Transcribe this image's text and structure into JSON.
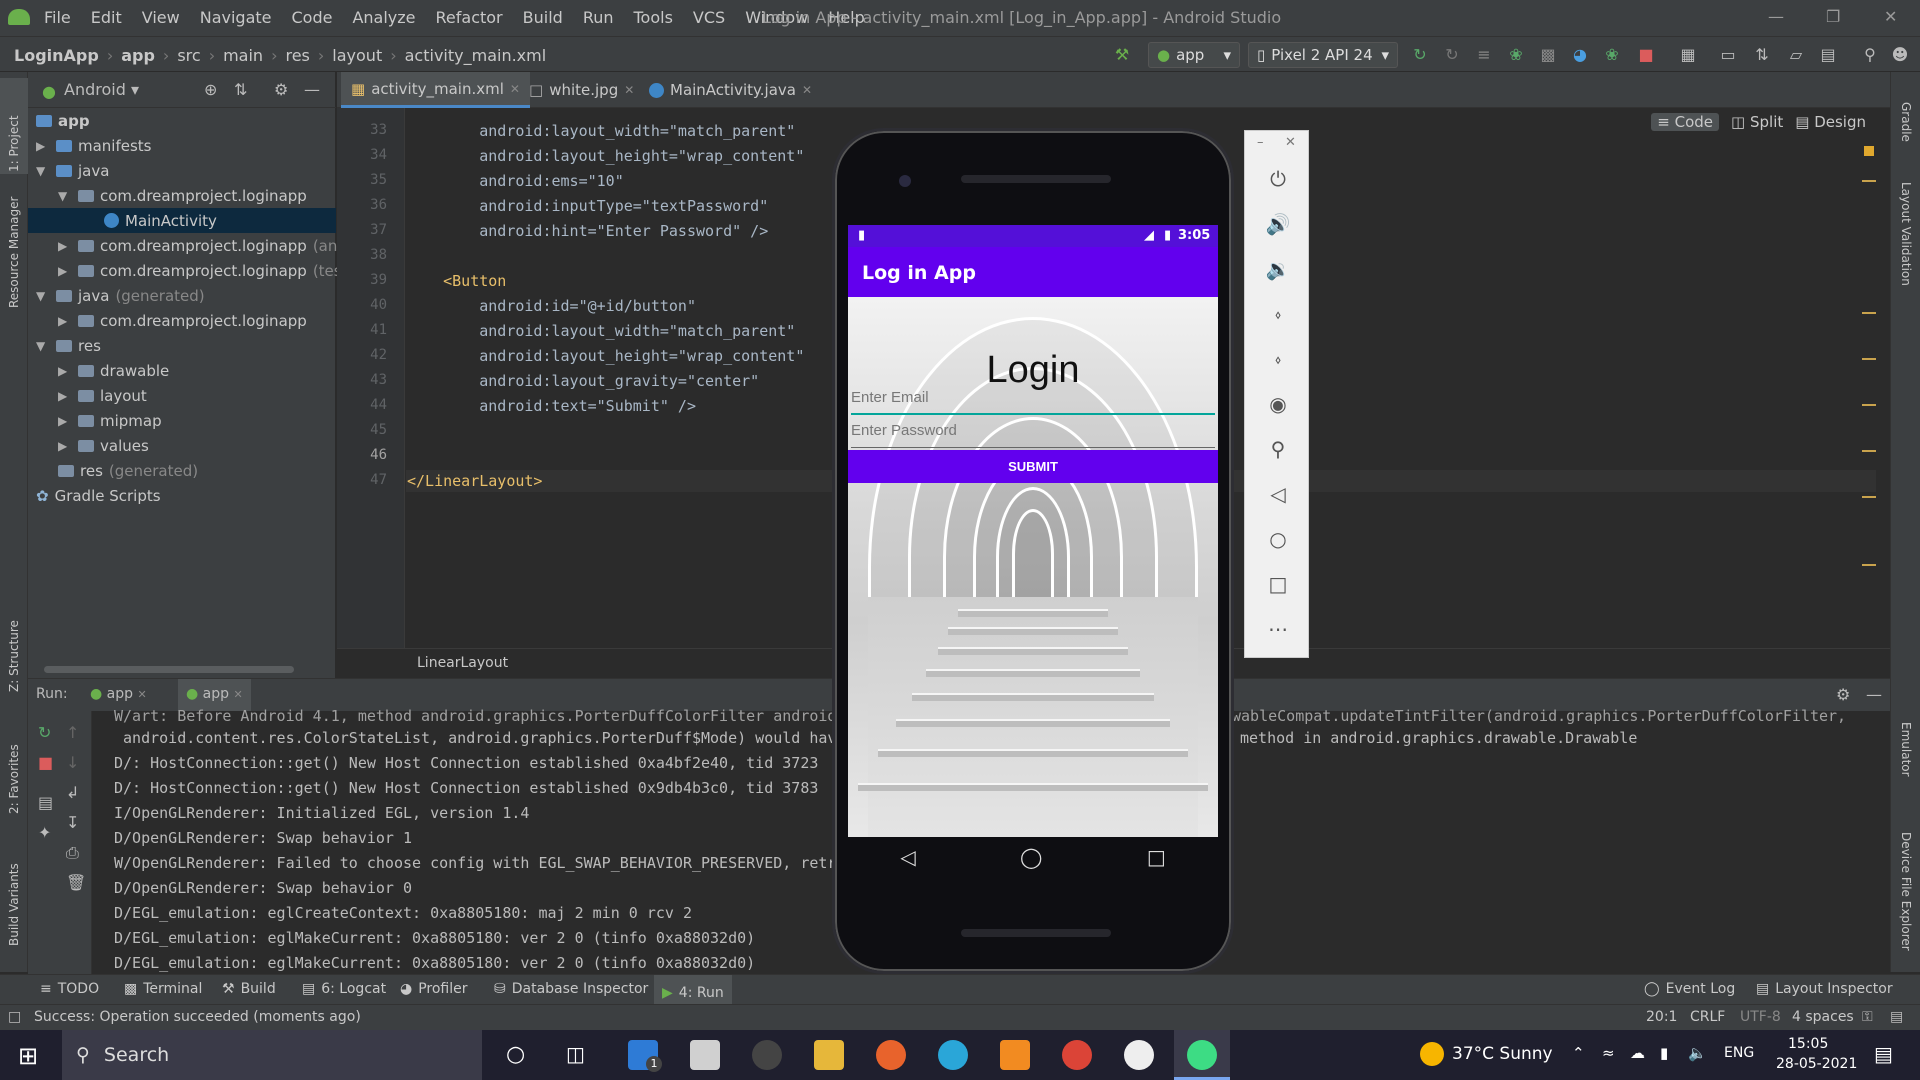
{
  "window": {
    "title": "Log in App - activity_main.xml [Log_in_App.app] - Android Studio",
    "menu": [
      "File",
      "Edit",
      "View",
      "Navigate",
      "Code",
      "Analyze",
      "Refactor",
      "Build",
      "Run",
      "Tools",
      "VCS",
      "Window",
      "Help"
    ]
  },
  "breadcrumb": [
    "LoginApp",
    "app",
    "src",
    "main",
    "res",
    "layout",
    "activity_main.xml"
  ],
  "toolbar": {
    "run_config": "app",
    "device": "Pixel 2 API 24"
  },
  "left_stripe": [
    "1: Project",
    "Resource Manager",
    "Z: Structure",
    "2: Favorites",
    "Build Variants"
  ],
  "right_stripe": [
    "Gradle",
    "Layout Validation",
    "Emulator",
    "Device File Explorer"
  ],
  "project": {
    "view_mode": "Android",
    "tree": [
      {
        "label": "app",
        "suffix": "",
        "icon": "folder",
        "expanded": true
      },
      {
        "label": "manifests",
        "suffix": "",
        "icon": "folder",
        "expanded": false
      },
      {
        "label": "java",
        "suffix": "",
        "icon": "folder",
        "expanded": true
      },
      {
        "label": "com.dreamproject.loginapp",
        "suffix": "",
        "icon": "package",
        "expanded": true
      },
      {
        "label": "MainActivity",
        "suffix": "",
        "icon": "class",
        "selected": true
      },
      {
        "label": "com.dreamproject.loginapp",
        "suffix": "(andro",
        "icon": "package",
        "expanded": false
      },
      {
        "label": "com.dreamproject.loginapp",
        "suffix": "(test)",
        "icon": "package",
        "expanded": false
      },
      {
        "label": "java",
        "suffix": "(generated)",
        "icon": "folder",
        "expanded": true
      },
      {
        "label": "com.dreamproject.loginapp",
        "suffix": "",
        "icon": "package",
        "expanded": false
      },
      {
        "label": "res",
        "suffix": "",
        "icon": "folder",
        "expanded": true
      },
      {
        "label": "drawable",
        "suffix": "",
        "icon": "folder",
        "expanded": false
      },
      {
        "label": "layout",
        "suffix": "",
        "icon": "folder",
        "expanded": false
      },
      {
        "label": "mipmap",
        "suffix": "",
        "icon": "folder",
        "expanded": false
      },
      {
        "label": "values",
        "suffix": "",
        "icon": "folder",
        "expanded": false
      },
      {
        "label": "res",
        "suffix": "(generated)",
        "icon": "folder"
      },
      {
        "label": "Gradle Scripts",
        "suffix": "",
        "icon": "gradle"
      }
    ]
  },
  "editor": {
    "tabs": [
      "activity_main.xml",
      "white.jpg",
      "MainActivity.java"
    ],
    "active_tab": 0,
    "view_modes": [
      "Code",
      "Split",
      "Design"
    ],
    "lines": [
      {
        "n": "33",
        "text": "        android:layout_width=\"match_parent\""
      },
      {
        "n": "34",
        "text": "        android:layout_height=\"wrap_content\""
      },
      {
        "n": "35",
        "text": "        android:ems=\"10\""
      },
      {
        "n": "36",
        "text": "        android:inputType=\"textPassword\""
      },
      {
        "n": "37",
        "text": "        android:hint=\"Enter Password\" />"
      },
      {
        "n": "38",
        "text": ""
      },
      {
        "n": "39",
        "text": "    <Button"
      },
      {
        "n": "40",
        "text": "        android:id=\"@+id/button\""
      },
      {
        "n": "41",
        "text": "        android:layout_width=\"match_parent\""
      },
      {
        "n": "42",
        "text": "        android:layout_height=\"wrap_content\""
      },
      {
        "n": "43",
        "text": "        android:layout_gravity=\"center\""
      },
      {
        "n": "44",
        "text": "        android:text=\"Submit\" />"
      },
      {
        "n": "45",
        "text": ""
      },
      {
        "n": "46",
        "text": ""
      },
      {
        "n": "47",
        "text": "</LinearLayout>"
      }
    ],
    "breadcrumb": "LinearLayout"
  },
  "run": {
    "label": "Run:",
    "tabs": [
      "app",
      "app"
    ],
    "logs": [
      "W/art: Before Android 4.1, method android.graphics.PorterDuffColorFilter android.",
      " android.content.res.ColorStateList, android.graphics.PorterDuff$Mode) would hav",
      "D/: HostConnection::get() New Host Connection established 0xa4bf2e40, tid 3723",
      "D/: HostConnection::get() New Host Connection established 0x9db4b3c0, tid 3783",
      "I/OpenGLRenderer: Initialized EGL, version 1.4",
      "D/OpenGLRenderer: Swap behavior 1",
      "W/OpenGLRenderer: Failed to choose config with EGL_SWAP_BEHAVIOR_PRESERVED, retr",
      "D/OpenGLRenderer: Swap behavior 0",
      "D/EGL_emulation: eglCreateContext: 0xa8805180: maj 2 min 0 rcv 2",
      "D/EGL_emulation: eglMakeCurrent: 0xa8805180: ver 2 0 (tinfo 0xa88032d0)",
      "D/EGL_emulation: eglMakeCurrent: 0xa8805180: ver 2 0 (tinfo 0xa88032d0)"
    ],
    "log_right_1": "wableCompat.updateTintFilter(android.graphics.PorterDuffColorFilter,",
    "log_right_2": "method in android.graphics.drawable.Drawable"
  },
  "bottom_tools": [
    "TODO",
    "Terminal",
    "Build",
    "6: Logcat",
    "Profiler",
    "Database Inspector",
    "4: Run"
  ],
  "bottom_right_tools": [
    "Event Log",
    "Layout Inspector"
  ],
  "status": {
    "message": "Success: Operation succeeded (moments ago)",
    "position": "20:1",
    "line_sep": "CRLF",
    "encoding": "UTF-8",
    "indent": "4 spaces"
  },
  "phone": {
    "time": "3:05",
    "app_title": "Log in App",
    "heading": "Login",
    "email_hint": "Enter Email",
    "password_hint": "Enter Password",
    "button": "SUBMIT",
    "accent": "#6200ee"
  },
  "taskbar": {
    "search": "Search",
    "weather": "37°C Sunny",
    "lang": "ENG",
    "time": "15:05",
    "date": "28-05-2021",
    "mail_badge": "1"
  }
}
